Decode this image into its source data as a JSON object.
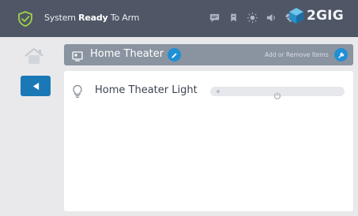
{
  "status_bar": {
    "status_prefix": "System",
    "status_bold": "Ready",
    "status_suffix": "To Arm",
    "brand": "2GIG",
    "icons": [
      "shield-check-icon",
      "message-icon",
      "bookmark-icon",
      "brightness-icon",
      "volume-icon",
      "pulse-icon",
      "2gig-cube-logo"
    ]
  },
  "nav": {
    "home_icon": "home-icon",
    "back_icon": "back-arrow-icon"
  },
  "room": {
    "title": "Home Theater",
    "add_remove_label": "Add or Remove Items"
  },
  "devices": [
    {
      "name": "Home Theater Light",
      "icon": "light-bulb-icon"
    }
  ],
  "colors": {
    "status_bar": "#4f5766",
    "room_bar": "#8a93a0",
    "accent_blue": "#1a78b7",
    "shield_green": "#9fd24a",
    "background": "#e9e9eb"
  }
}
